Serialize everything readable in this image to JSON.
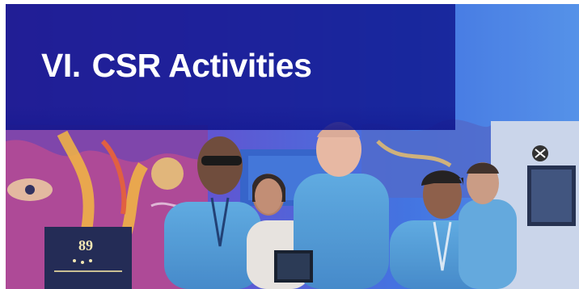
{
  "slide": {
    "section_number": "VI.",
    "section_title": "CSR Activities"
  },
  "photo": {
    "description_icon": "group-photo-image",
    "banner_number": "89",
    "colors": {
      "banner_overlay": "#0e148c",
      "background_wall": "#3d57c8",
      "shirts": "#4f9ed8",
      "title_text": "#ffffff"
    }
  }
}
